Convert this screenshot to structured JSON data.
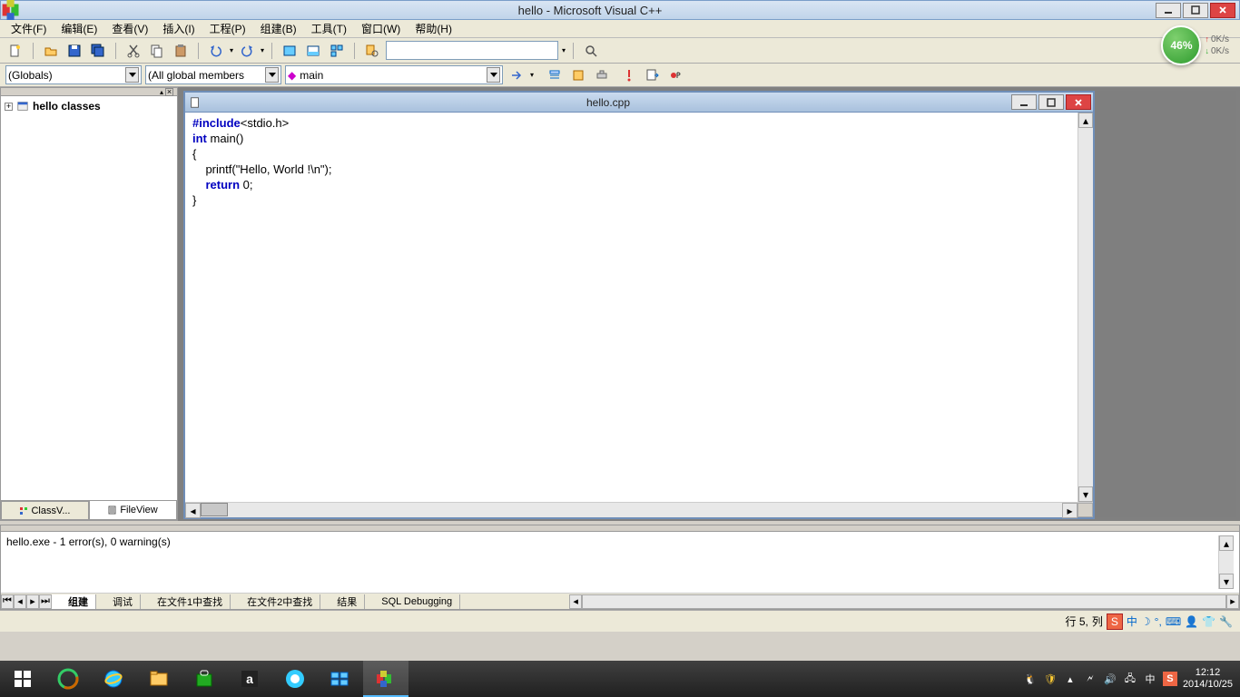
{
  "window": {
    "title": "hello - Microsoft Visual C++"
  },
  "menubar": [
    "文件(F)",
    "编辑(E)",
    "查看(V)",
    "插入(I)",
    "工程(P)",
    "组建(B)",
    "工具(T)",
    "窗口(W)",
    "帮助(H)"
  ],
  "combos": {
    "scope": "(Globals)",
    "members": "(All global members",
    "function": "main"
  },
  "sidebar": {
    "tree_root": "hello classes",
    "tabs": {
      "classview": "ClassV...",
      "fileview": "FileView"
    }
  },
  "editor": {
    "filename": "hello.cpp",
    "code": {
      "line1_kw": "#include",
      "line1_rest": "<stdio.h>",
      "line2_kw": "int",
      "line2_rest": " main()",
      "line3": "{",
      "line4_a": "    printf(",
      "line4_b": "\"Hello, World !\\n\"",
      "line4_c": ");",
      "line5_a": "    ",
      "line5_kw": "return",
      "line5_b": " 0;",
      "line6": "}"
    }
  },
  "output": {
    "text": "hello.exe - 1 error(s), 0 warning(s)",
    "tabs": [
      "组建",
      "调试",
      "在文件1中查找",
      "在文件2中查找",
      "结果",
      "SQL Debugging"
    ]
  },
  "status": {
    "line": "行 5,",
    "col": "列"
  },
  "net": {
    "pct": "46%",
    "up": "0K/s",
    "dn": "0K/s"
  },
  "taskbar": {
    "time": "12:12",
    "date": "2014/10/25"
  },
  "ime": {
    "cn": "中",
    "sogou": "S"
  }
}
